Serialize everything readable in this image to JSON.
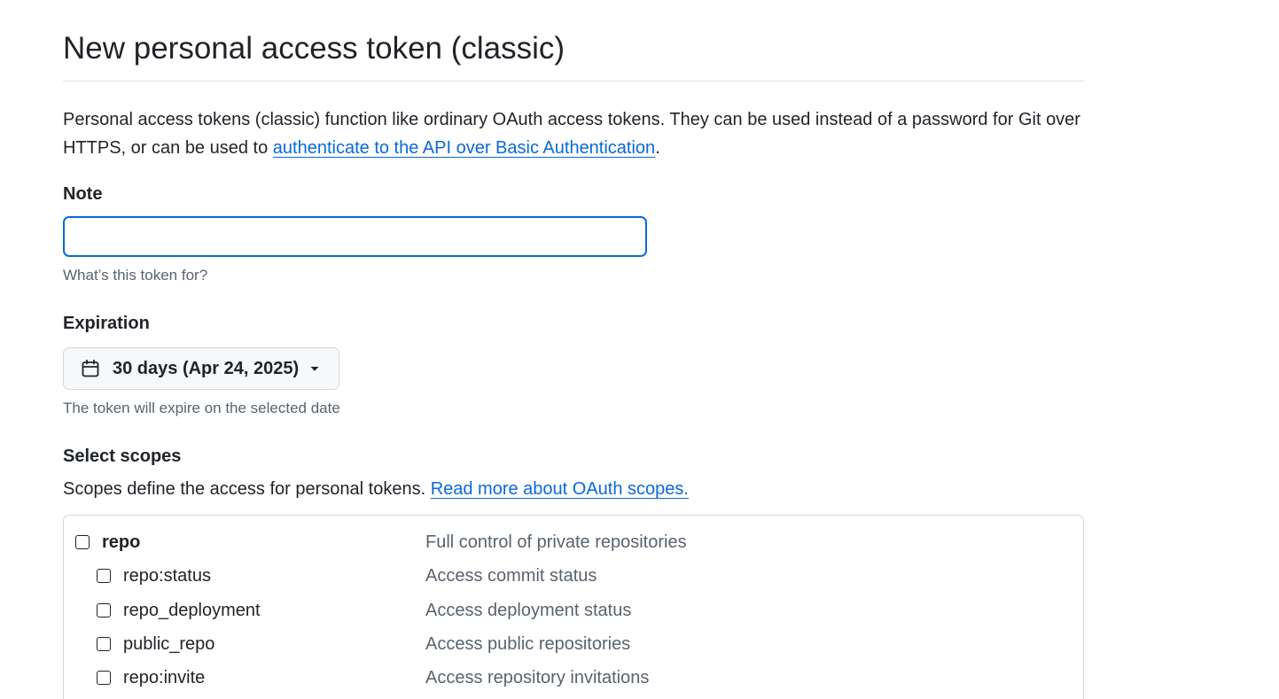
{
  "page": {
    "title": "New personal access token (classic)"
  },
  "intro": {
    "text_before": "Personal access tokens (classic) function like ordinary OAuth access tokens. They can be used instead of a password for Git over HTTPS, or can be used to ",
    "link_text": "authenticate to the API over Basic Authentication",
    "text_after": "."
  },
  "note": {
    "label": "Note",
    "value": "",
    "placeholder": "",
    "hint": "What’s this token for?"
  },
  "expiration": {
    "label": "Expiration",
    "selected": "30 days (Apr 24, 2025)",
    "icon": "calendar-icon",
    "caret_icon": "triangle-down-icon",
    "hint": "The token will expire on the selected date"
  },
  "scopes": {
    "label": "Select scopes",
    "description": "Scopes define the access for personal tokens. ",
    "link_text": "Read more about OAuth scopes.",
    "items": [
      {
        "name": "repo",
        "description": "Full control of private repositories",
        "checked": false,
        "parent": true
      },
      {
        "name": "repo:status",
        "description": "Access commit status",
        "checked": false,
        "parent": false
      },
      {
        "name": "repo_deployment",
        "description": "Access deployment status",
        "checked": false,
        "parent": false
      },
      {
        "name": "public_repo",
        "description": "Access public repositories",
        "checked": false,
        "parent": false
      },
      {
        "name": "repo:invite",
        "description": "Access repository invitations",
        "checked": false,
        "parent": false
      }
    ]
  },
  "colors": {
    "link": "#0969da",
    "text": "#1f2328",
    "muted": "#59636e",
    "border": "#d1d9e0"
  }
}
